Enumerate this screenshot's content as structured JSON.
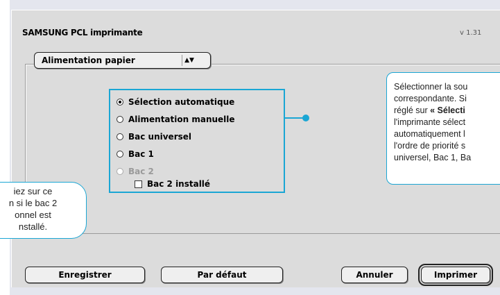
{
  "dialog": {
    "title": "SAMSUNG PCL imprimante",
    "version": "v 1.31",
    "section_popup": "Alimentation papier"
  },
  "source": {
    "options": [
      {
        "label": "Sélection automatique",
        "selected": true,
        "enabled": true
      },
      {
        "label": "Alimentation manuelle",
        "selected": false,
        "enabled": true
      },
      {
        "label": "Bac universel",
        "selected": false,
        "enabled": true
      },
      {
        "label": "Bac 1",
        "selected": false,
        "enabled": true
      },
      {
        "label": "Bac 2",
        "selected": false,
        "enabled": false
      }
    ],
    "checkbox_label": "Bac 2 installé"
  },
  "buttons": {
    "save": "Enregistrer",
    "defaults": "Par défaut",
    "cancel": "Annuler",
    "print": "Imprimer"
  },
  "callouts": {
    "right_lines": [
      "Sélectionner la sou",
      "correspondante. Si",
      "réglé sur ",
      "l'imprimante sélect",
      "automatiquement l",
      "l'ordre de priorité s",
      "universel, Bac 1, Ba"
    ],
    "right_bold": "« Sélecti",
    "left_lines": [
      "iez sur ce",
      "n si le bac 2",
      "onnel est",
      "nstallé."
    ]
  },
  "colors": {
    "accent": "#1aa6d4",
    "dialog_bg": "#dcdcdc"
  }
}
